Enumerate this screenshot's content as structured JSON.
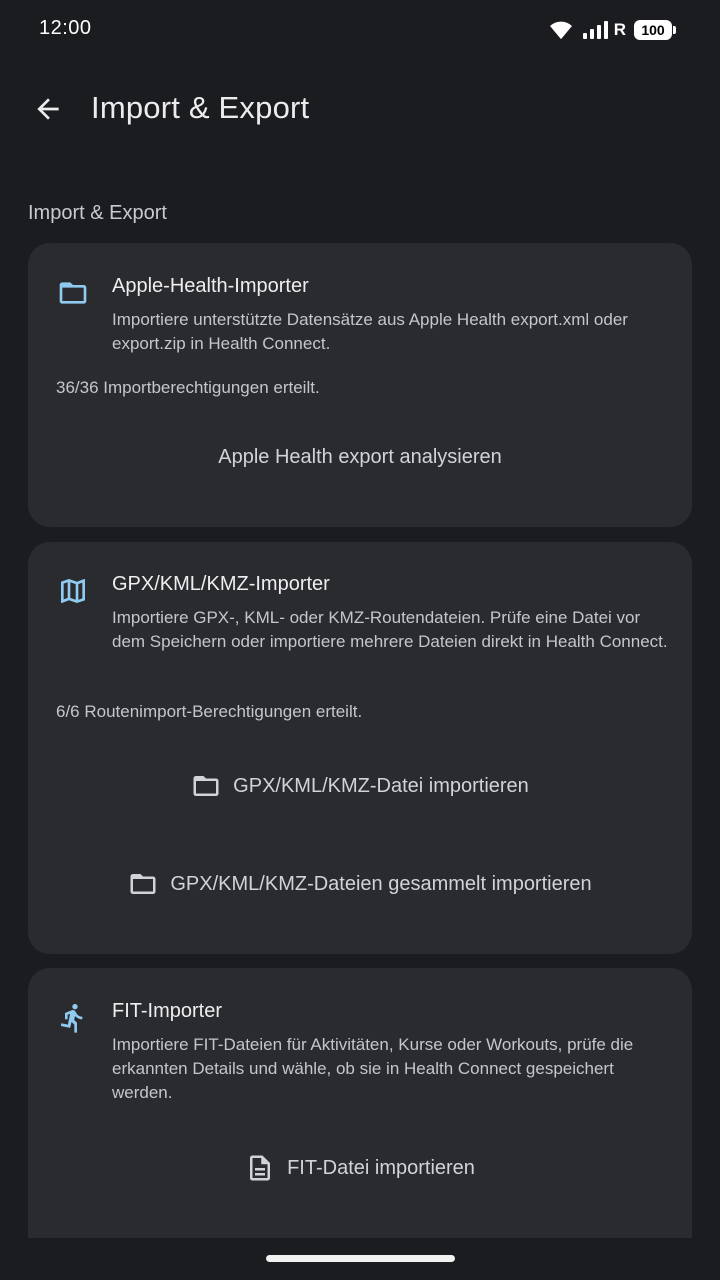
{
  "status_bar": {
    "time": "12:00",
    "network_label": "R",
    "battery": "100"
  },
  "app_bar": {
    "title": "Import & Export"
  },
  "section": {
    "label": "Import & Export"
  },
  "cards": [
    {
      "title": "Apple-Health-Importer",
      "description": "Importiere unterstützte Datensätze aus Apple Health export.xml oder export.zip in Health Connect.",
      "status": "36/36 Importberechtigungen erteilt.",
      "actions": [
        "Apple Health export analysieren"
      ],
      "icon": "folder-icon"
    },
    {
      "title": "GPX/KML/KMZ-Importer",
      "description": "Importiere GPX-, KML- oder KMZ-Routendateien. Prüfe eine Datei vor dem Speichern oder importiere mehrere Dateien direkt in Health Connect.",
      "status": "6/6 Routenimport-Berechtigungen erteilt.",
      "actions": [
        "GPX/KML/KMZ-Datei importieren",
        "GPX/KML/KMZ-Dateien gesammelt importieren"
      ],
      "icon": "map-icon"
    },
    {
      "title": "FIT-Importer",
      "description": "Importiere FIT-Dateien für Aktivitäten, Kurse oder Workouts, prüfe die erkannten Details und wähle, ob sie in Health Connect gespeichert werden.",
      "actions": [
        "FIT-Datei importieren"
      ],
      "icon": "running-person-icon"
    }
  ],
  "colors": {
    "background": "#1b1c1f",
    "card": "#2a2b2f",
    "accent_icon": "#8ecbef"
  }
}
